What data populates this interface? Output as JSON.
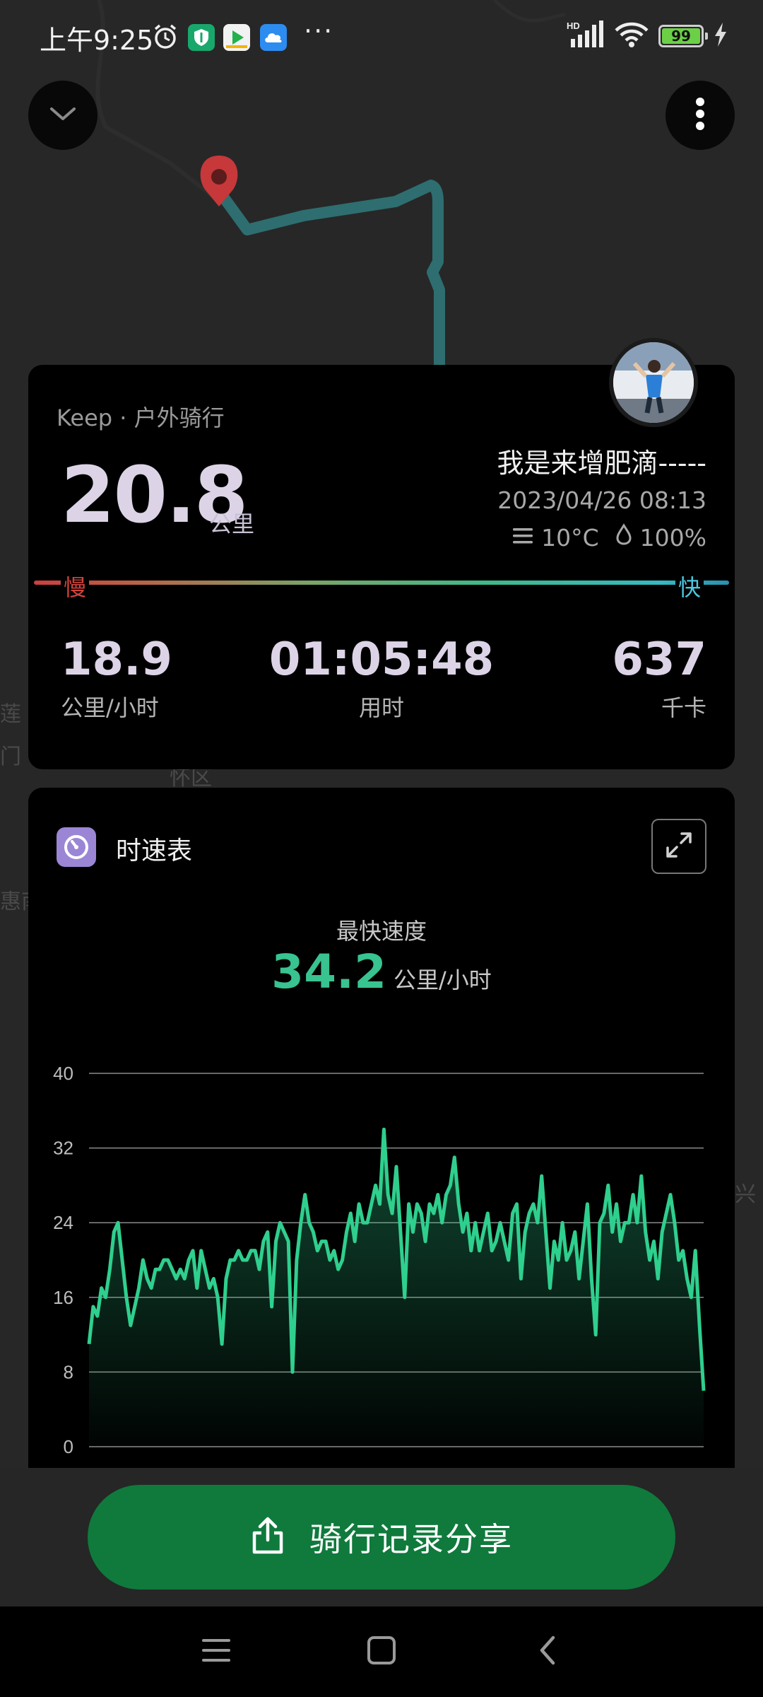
{
  "status_bar": {
    "time": "上午9:25",
    "more": "···",
    "battery": "99",
    "network": "HD"
  },
  "map": {
    "labels": [
      "莲",
      "门",
      "怀区",
      "惠南",
      "兴"
    ]
  },
  "summary": {
    "source": "Keep · 户外骑行",
    "distance": "20.8",
    "distance_unit": "公里",
    "username": "我是来增肥滴-----",
    "datetime": "2023/04/26 08:13",
    "temperature": "10°C",
    "humidity": "100%",
    "slow_label": "慢",
    "fast_label": "快",
    "stats": [
      {
        "value": "18.9",
        "label": "公里/小时"
      },
      {
        "value": "01:05:48",
        "label": "用时"
      },
      {
        "value": "637",
        "label": "千卡"
      }
    ]
  },
  "speed_card": {
    "title": "时速表",
    "max_label": "最快速度",
    "max_value": "34.2",
    "max_unit": "公里/小时"
  },
  "chart_data": {
    "type": "area",
    "title": "",
    "xlabel": "",
    "ylabel": "",
    "ylim": [
      0,
      40
    ],
    "yticks": [
      0,
      8,
      16,
      24,
      32,
      40
    ],
    "grid": true,
    "color": "#2fcf8e",
    "series": [
      {
        "values": [
          11,
          15,
          14,
          17,
          16,
          19,
          23,
          24,
          20,
          16,
          13,
          15,
          17,
          20,
          18,
          17,
          19,
          19,
          20,
          20,
          19,
          18,
          19,
          18,
          20,
          21,
          17,
          21,
          19,
          17,
          18,
          16,
          11,
          18,
          20,
          20,
          21,
          20,
          20,
          21,
          21,
          19,
          22,
          23,
          15,
          22,
          24,
          23,
          22,
          8,
          20,
          24,
          27,
          24,
          23,
          21,
          22,
          22,
          20,
          21,
          19,
          20,
          23,
          25,
          22,
          26,
          24,
          24,
          26,
          28,
          26,
          34,
          27,
          25,
          30,
          23,
          16,
          26,
          23,
          26,
          25,
          22,
          26,
          25,
          27,
          24,
          27,
          28,
          31,
          26,
          23,
          25,
          21,
          24,
          21,
          23,
          25,
          21,
          22,
          24,
          22,
          20,
          25,
          26,
          18,
          23,
          25,
          26,
          24,
          29,
          23,
          17,
          22,
          20,
          24,
          20,
          21,
          23,
          18,
          22,
          26,
          18,
          12,
          24,
          25,
          28,
          23,
          26,
          22,
          24,
          24,
          27,
          24,
          29,
          23,
          20,
          22,
          18,
          23,
          25,
          27,
          24,
          20,
          21,
          18,
          16,
          21,
          13,
          6
        ]
      }
    ]
  },
  "share": {
    "label": "骑行记录分享"
  },
  "colors": {
    "accent_green": "#2fcf8e",
    "button_green": "#0f7a3c",
    "card_bg": "#000000",
    "slow_red": "#d2423c",
    "fast_blue": "#4cc7e0"
  },
  "icons": [
    "alarm-icon",
    "shield-app-icon",
    "video-app-icon",
    "cloud-app-icon",
    "signal-icon",
    "wifi-icon",
    "battery-icon",
    "charging-icon",
    "collapse-chevron-icon",
    "more-vertical-icon",
    "map-pin-icon",
    "avatar",
    "weather-icon",
    "humidity-drop-icon",
    "speedometer-icon",
    "expand-icon",
    "share-icon",
    "menu-icon",
    "home-icon",
    "back-icon"
  ]
}
